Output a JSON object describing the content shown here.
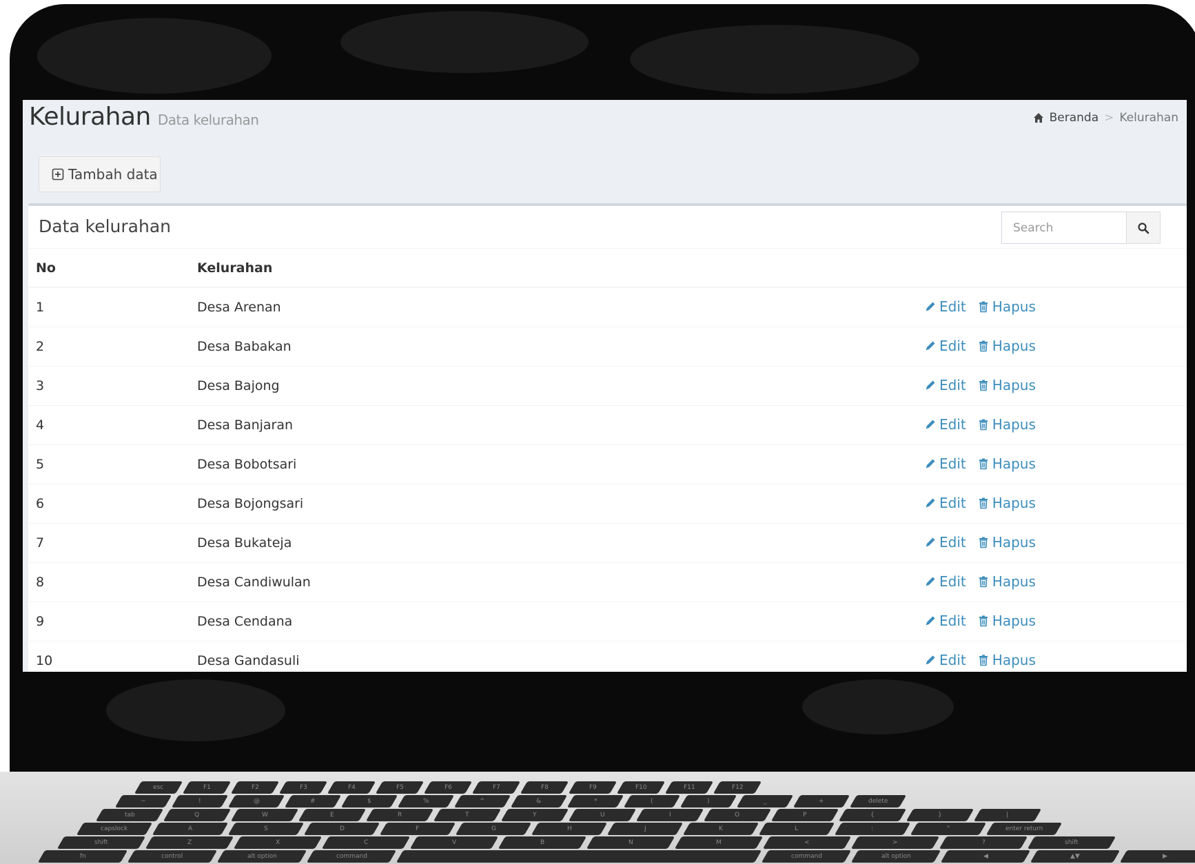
{
  "page": {
    "title": "Kelurahan",
    "subtitle": "Data kelurahan"
  },
  "breadcrumb": {
    "home": "Beranda",
    "separator": ">",
    "current": "Kelurahan"
  },
  "toolbar": {
    "add_label": "Tambah data"
  },
  "box": {
    "title": "Data kelurahan",
    "search_placeholder": "Search"
  },
  "table": {
    "headers": [
      "No",
      "Kelurahan",
      ""
    ],
    "edit_label": "Edit",
    "delete_label": "Hapus",
    "rows": [
      {
        "no": "1",
        "name": "Desa Arenan"
      },
      {
        "no": "2",
        "name": "Desa Babakan"
      },
      {
        "no": "3",
        "name": "Desa Bajong"
      },
      {
        "no": "4",
        "name": "Desa Banjaran"
      },
      {
        "no": "5",
        "name": "Desa Bobotsari"
      },
      {
        "no": "6",
        "name": "Desa Bojongsari"
      },
      {
        "no": "7",
        "name": "Desa Bukateja"
      },
      {
        "no": "8",
        "name": "Desa Candiwulan"
      },
      {
        "no": "9",
        "name": "Desa Cendana"
      },
      {
        "no": "10",
        "name": "Desa Gandasuli"
      }
    ]
  },
  "keyboard": {
    "rows": [
      [
        "esc",
        "F1",
        "F2",
        "F3",
        "F4",
        "F5",
        "F6",
        "F7",
        "F8",
        "F9",
        "F10",
        "F11",
        "F12"
      ],
      [
        "~",
        "!",
        "@",
        "#",
        "$",
        "%",
        "^",
        "&",
        "*",
        "(",
        ")",
        "_",
        "+",
        "delete"
      ],
      [
        "tab",
        "Q",
        "W",
        "E",
        "R",
        "T",
        "Y",
        "U",
        "I",
        "O",
        "P",
        "{",
        "}",
        "|"
      ],
      [
        "capslock",
        "A",
        "S",
        "D",
        "F",
        "G",
        "H",
        "J",
        "K",
        "L",
        ":",
        "\"",
        "enter return"
      ],
      [
        "shift",
        "Z",
        "X",
        "C",
        "V",
        "B",
        "N",
        "M",
        "<",
        ">",
        "?",
        "shift"
      ],
      [
        "fn",
        "control",
        "alt option",
        "command",
        "",
        "command",
        "alt option",
        "◀",
        "▲▼",
        "▶"
      ]
    ]
  },
  "colors": {
    "link": "#3c8dbc",
    "content_bg": "#ecf0f5",
    "box_border": "#d2d6de",
    "laptop": "#0a0a0a"
  },
  "icons": {
    "home": "home-icon",
    "add": "plus-square-icon",
    "search": "search-icon",
    "edit": "pencil-icon",
    "delete": "trash-icon"
  }
}
